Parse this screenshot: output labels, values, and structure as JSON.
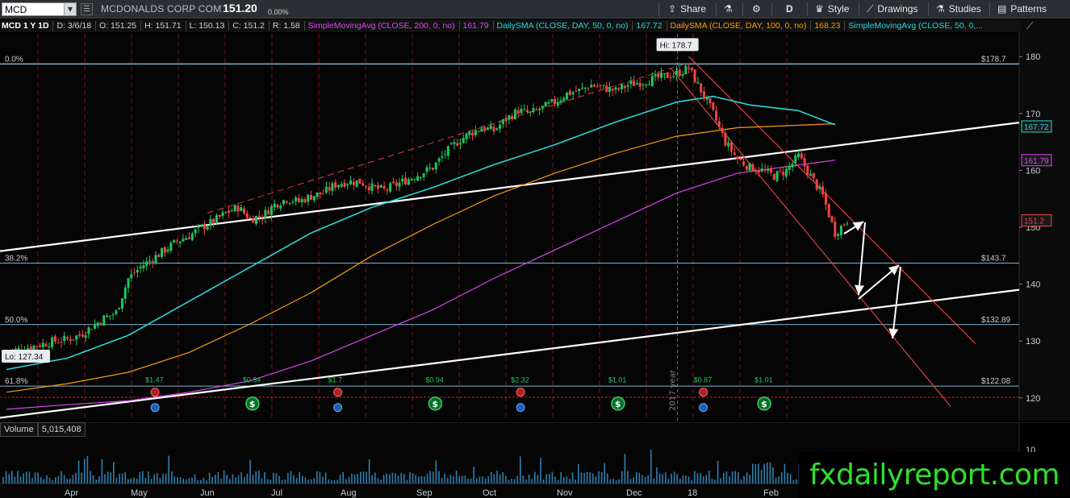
{
  "toolbar": {
    "symbol": "MCD",
    "company": "MCDONALDS CORP COM",
    "last_price": "151.20",
    "pct_change": "0.00%",
    "share_label": "Share",
    "timeframe_label": "D",
    "style_label": "Style",
    "drawings_label": "Drawings",
    "studies_label": "Studies",
    "patterns_label": "Patterns"
  },
  "info_row": {
    "chart_label": "MCD 1 Y 1D",
    "date": "D: 3/6/18",
    "open": "O: 151.25",
    "high": "H: 151.71",
    "low": "L: 150.13",
    "close": "C: 151.2",
    "range": "R: 1.58",
    "sma200_label": "SimpleMovingAvg (CLOSE, 200, 0, no)",
    "sma200_value": "161.79",
    "sma50_label": "DailySMA (CLOSE, DAY, 50, 0, no)",
    "sma50_value": "167.72",
    "sma100_label": "DailySMA (CLOSE, DAY, 100, 0, no)",
    "sma100_value": "168.23",
    "sma50b_label": "SimpleMovingAvg (CLOSE, 50, 0,..."
  },
  "colors": {
    "background": "#000000",
    "bull": "#22c55e",
    "bear": "#ef4444",
    "sma200": "#d946ef",
    "sma50": "#2bd4d9",
    "sma100": "#f59e0b",
    "fib": "#7fb3d6",
    "watermark": "#2ee02e"
  },
  "price_axis": {
    "ticks": [
      "180",
      "170",
      "160",
      "150",
      "140",
      "130",
      "120"
    ],
    "tags": [
      {
        "label": "$178.7",
        "price": 178.7
      },
      {
        "label": "$143.7",
        "price": 143.7
      },
      {
        "label": "$132.89",
        "price": 132.89
      },
      {
        "label": "$122.08",
        "price": 122.08
      }
    ],
    "badges": [
      {
        "label": "167.72",
        "price": 167.72,
        "color": "#2bd4d9"
      },
      {
        "label": "161.79",
        "price": 161.79,
        "color": "#d946ef"
      },
      {
        "label": "151.2",
        "price": 151.2,
        "color": "#ef4444"
      }
    ]
  },
  "fib_levels": [
    {
      "label": "0.0%",
      "price": 178.7
    },
    {
      "label": "38.2%",
      "price": 143.7
    },
    {
      "label": "50.0%",
      "price": 132.89
    },
    {
      "label": "61.8%",
      "price": 122.08
    }
  ],
  "annotations": {
    "high": "Hi: 178.7",
    "low": "Lo: 127.34",
    "year": "2017 year"
  },
  "dividends": [
    {
      "label": "$1.47",
      "m": 2.2
    },
    {
      "label": "$0.94",
      "m": 3.8
    },
    {
      "label": "$1.7",
      "m": 5.2
    },
    {
      "label": "$0.94",
      "m": 6.8
    },
    {
      "label": "$2.32",
      "m": 8.2
    },
    {
      "label": "$1.01",
      "m": 9.8
    },
    {
      "label": "$0.87",
      "m": 11.2
    },
    {
      "label": "$1.01",
      "m": 12.2
    }
  ],
  "x_axis": {
    "labels": [
      "Apr",
      "May",
      "Jun",
      "Jul",
      "Aug",
      "Sep",
      "Oct",
      "Nov",
      "Dec",
      "18",
      "Feb"
    ]
  },
  "volume": {
    "label": "Volume",
    "value": "5,015,408",
    "tick": "10"
  },
  "chart_data": {
    "type": "candlestick",
    "ylim": [
      116,
      184
    ],
    "series": [
      {
        "name": "MCD",
        "points": [
          [
            0,
            128
          ],
          [
            0.2,
            128.5
          ],
          [
            0.4,
            129
          ],
          [
            0.6,
            129.5
          ],
          [
            0.8,
            130
          ],
          [
            1,
            130.3
          ],
          [
            1.2,
            131
          ],
          [
            1.4,
            132.5
          ],
          [
            1.6,
            134
          ],
          [
            1.8,
            135
          ],
          [
            2,
            141
          ],
          [
            2.2,
            143
          ],
          [
            2.4,
            144.5
          ],
          [
            2.6,
            146
          ],
          [
            2.8,
            147.5
          ],
          [
            3,
            148.5
          ],
          [
            3.2,
            150
          ],
          [
            3.4,
            151
          ],
          [
            3.6,
            152.5
          ],
          [
            3.8,
            153.5
          ],
          [
            4,
            151.5
          ],
          [
            4.2,
            152
          ],
          [
            4.4,
            154
          ],
          [
            4.6,
            155
          ],
          [
            4.8,
            154.5
          ],
          [
            5,
            155.5
          ],
          [
            5.2,
            156
          ],
          [
            5.4,
            157.5
          ],
          [
            5.6,
            158
          ],
          [
            5.8,
            158
          ],
          [
            6,
            157
          ],
          [
            6.2,
            156.5
          ],
          [
            6.4,
            157.5
          ],
          [
            6.6,
            158.5
          ],
          [
            6.8,
            159.5
          ],
          [
            7,
            160.5
          ],
          [
            7.2,
            163
          ],
          [
            7.4,
            165
          ],
          [
            7.6,
            166.5
          ],
          [
            7.8,
            167.5
          ],
          [
            8,
            167
          ],
          [
            8.2,
            169
          ],
          [
            8.4,
            170.5
          ],
          [
            8.6,
            170
          ],
          [
            8.8,
            171
          ],
          [
            9,
            172
          ],
          [
            9.2,
            173.5
          ],
          [
            9.4,
            174
          ],
          [
            9.6,
            175
          ],
          [
            9.8,
            174.5
          ],
          [
            10,
            174
          ],
          [
            10.2,
            175
          ],
          [
            10.4,
            175.5
          ],
          [
            10.6,
            176
          ],
          [
            10.8,
            176.5
          ],
          [
            11,
            177
          ],
          [
            11.2,
            178
          ],
          [
            11.4,
            174
          ],
          [
            11.6,
            170
          ],
          [
            11.8,
            165
          ],
          [
            12,
            162
          ],
          [
            12.2,
            160.5
          ],
          [
            12.4,
            160
          ],
          [
            12.6,
            159
          ],
          [
            12.8,
            160
          ],
          [
            13,
            162.5
          ],
          [
            13.2,
            159
          ],
          [
            13.4,
            155.5
          ],
          [
            13.6,
            149
          ],
          [
            13.8,
            151.2
          ]
        ]
      },
      {
        "name": "SMA 50",
        "points": [
          [
            0,
            125
          ],
          [
            1,
            127
          ],
          [
            2,
            131
          ],
          [
            3,
            137
          ],
          [
            4,
            143
          ],
          [
            5,
            149
          ],
          [
            6,
            153.5
          ],
          [
            7,
            157
          ],
          [
            8,
            161
          ],
          [
            9,
            164.5
          ],
          [
            10,
            168.5
          ],
          [
            11,
            172
          ],
          [
            11.6,
            173
          ],
          [
            12.2,
            171.5
          ],
          [
            13,
            170.5
          ],
          [
            13.6,
            168
          ]
        ]
      },
      {
        "name": "SMA 100",
        "points": [
          [
            0,
            121
          ],
          [
            1,
            122.5
          ],
          [
            2,
            124.5
          ],
          [
            3,
            128
          ],
          [
            4,
            133
          ],
          [
            5,
            138.5
          ],
          [
            6,
            145
          ],
          [
            7,
            150.5
          ],
          [
            8,
            155.5
          ],
          [
            9,
            159.5
          ],
          [
            10,
            163
          ],
          [
            11,
            166
          ],
          [
            12,
            167.5
          ],
          [
            13.6,
            168.2
          ]
        ]
      },
      {
        "name": "SMA 200",
        "points": [
          [
            0,
            118
          ],
          [
            1,
            118.8
          ],
          [
            2,
            119.5
          ],
          [
            3,
            121
          ],
          [
            4,
            123
          ],
          [
            5,
            126.5
          ],
          [
            6,
            131
          ],
          [
            7,
            135.5
          ],
          [
            8,
            141
          ],
          [
            9,
            146
          ],
          [
            10,
            151
          ],
          [
            11,
            156
          ],
          [
            12,
            159.5
          ],
          [
            13.6,
            161.8
          ]
        ]
      }
    ]
  }
}
